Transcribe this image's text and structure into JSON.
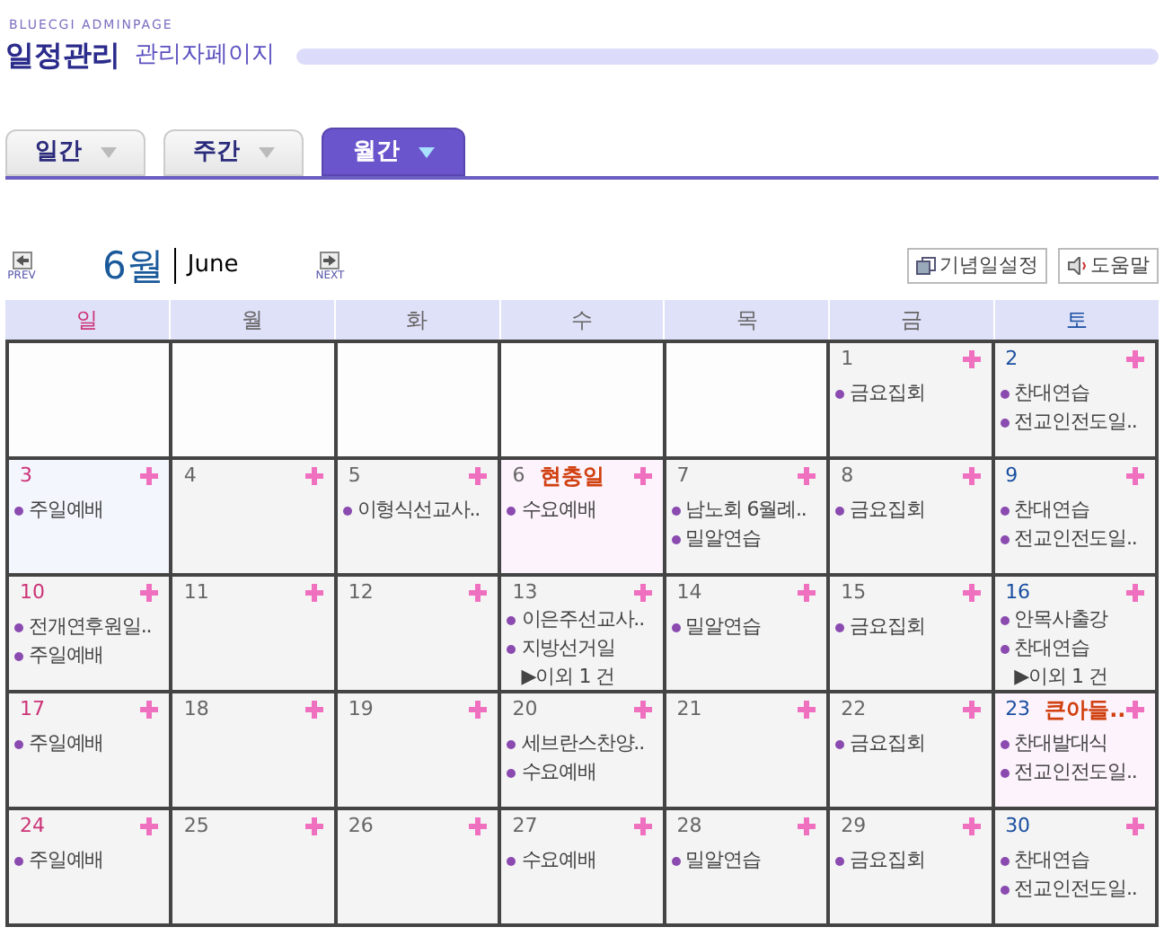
{
  "header": {
    "brand": "BLUECGI ADMINPAGE",
    "title": "일정관리",
    "subtitle": "관리자페이지"
  },
  "tabs": [
    {
      "label": "일간",
      "selected": false
    },
    {
      "label": "주간",
      "selected": false
    },
    {
      "label": "월간",
      "selected": true
    }
  ],
  "nav": {
    "prev": "PREV",
    "month": "6월",
    "month_name": "June",
    "next": "NEXT",
    "buttons": [
      {
        "kind": "anniversary",
        "label": "기념일설정"
      },
      {
        "kind": "help",
        "label": "도움말"
      }
    ]
  },
  "weekdays": [
    "일",
    "월",
    "화",
    "수",
    "목",
    "금",
    "토"
  ],
  "weeks": [
    {
      "days": [
        {
          "kind": "blank"
        },
        {
          "kind": "blank"
        },
        {
          "kind": "blank"
        },
        {
          "kind": "blank"
        },
        {
          "kind": "blank"
        },
        {
          "day": "1",
          "items": [
            "금요집회"
          ]
        },
        {
          "day": "2",
          "items": [
            "찬대연습",
            "전교인전도일.."
          ]
        }
      ]
    },
    {
      "days": [
        {
          "day": "3",
          "color": "#f4f6fe",
          "items": [
            "주일예배"
          ]
        },
        {
          "day": "4"
        },
        {
          "day": "5",
          "items": [
            "이형식선교사.."
          ]
        },
        {
          "day": "6",
          "color": "#fdf3fc",
          "holiday": "현충일",
          "items": [
            "수요예배"
          ]
        },
        {
          "day": "7",
          "items": [
            "남노회 6월례..",
            "밀알연습"
          ]
        },
        {
          "day": "8",
          "items": [
            "금요집회"
          ]
        },
        {
          "day": "9",
          "items": [
            "찬대연습",
            "전교인전도일.."
          ]
        }
      ]
    },
    {
      "days": [
        {
          "day": "10",
          "items": [
            "전개연후원일..",
            "주일예배"
          ]
        },
        {
          "day": "11"
        },
        {
          "day": "12"
        },
        {
          "day": "13",
          "items": [
            "이은주선교사..",
            "지방선거일"
          ],
          "more": "▶이외 1 건"
        },
        {
          "day": "14",
          "items": [
            "밀알연습"
          ]
        },
        {
          "day": "15",
          "items": [
            "금요집회"
          ]
        },
        {
          "day": "16",
          "items": [
            "안목사출강",
            "찬대연습"
          ],
          "more": "▶이외 1 건"
        }
      ]
    },
    {
      "days": [
        {
          "day": "17",
          "items": [
            "주일예배"
          ]
        },
        {
          "day": "18"
        },
        {
          "day": "19"
        },
        {
          "day": "20",
          "items": [
            "세브란스찬양..",
            "수요예배"
          ]
        },
        {
          "day": "21"
        },
        {
          "day": "22",
          "items": [
            "금요집회"
          ]
        },
        {
          "day": "23",
          "color": "#fdf3fc",
          "holiday": "큰아들..",
          "items": [
            "찬대발대식",
            "전교인전도일.."
          ]
        }
      ]
    },
    {
      "days": [
        {
          "day": "24",
          "items": [
            "주일예배"
          ]
        },
        {
          "day": "25"
        },
        {
          "day": "26"
        },
        {
          "day": "27",
          "items": [
            "수요예배"
          ]
        },
        {
          "day": "28",
          "items": [
            "밀알연습"
          ]
        },
        {
          "day": "29",
          "items": [
            "금요집회"
          ]
        },
        {
          "day": "30",
          "items": [
            "찬대연습",
            "전교인전도일.."
          ]
        }
      ]
    }
  ]
}
